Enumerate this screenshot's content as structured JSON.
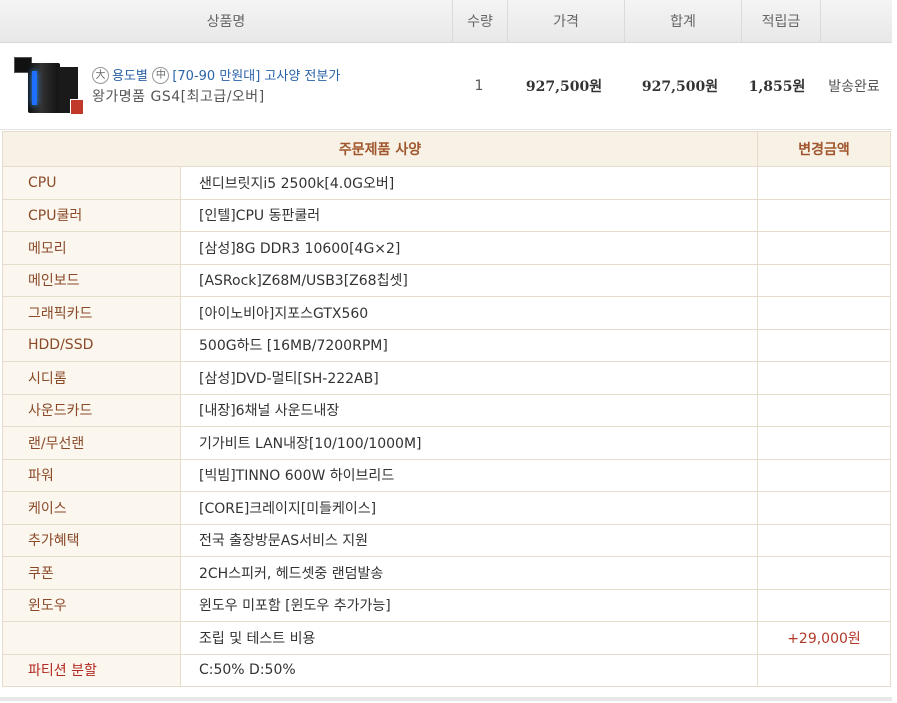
{
  "order_header": {
    "product": "상품명",
    "qty": "수량",
    "price": "가격",
    "total": "합계",
    "points": "적립금",
    "status": ""
  },
  "product": {
    "icon_big": "大",
    "category_a": "용도별",
    "icon_mid": "中",
    "category_b": "[70-90 만원대] 고사양 전분가",
    "name": "왕가명품 GS4[최고급/오버]",
    "qty": "1",
    "price": "927,500원",
    "total": "927,500원",
    "points": "1,855원",
    "status": "발송완료"
  },
  "spec_header": {
    "spec": "주문제품 사양",
    "change": "변경금액"
  },
  "specs": [
    {
      "label": "CPU",
      "value": "샌디브릿지i5 2500k[4.0G오버]",
      "change": ""
    },
    {
      "label": "CPU쿨러",
      "value": "[인텔]CPU 동판쿨러",
      "change": ""
    },
    {
      "label": "메모리",
      "value": "[삼성]8G DDR3 10600[4G×2]",
      "change": ""
    },
    {
      "label": "메인보드",
      "value": "[ASRock]Z68M/USB3[Z68칩셋]",
      "change": ""
    },
    {
      "label": "그래픽카드",
      "value": "[아이노비아]지포스GTX560",
      "change": ""
    },
    {
      "label": "HDD/SSD",
      "value": "500G하드 [16MB/7200RPM]",
      "change": ""
    },
    {
      "label": "시디롬",
      "value": "[삼성]DVD-멀티[SH-222AB]",
      "change": ""
    },
    {
      "label": "사운드카드",
      "value": "[내장]6채널 사운드내장",
      "change": ""
    },
    {
      "label": "랜/무선랜",
      "value": "기가비트 LAN내장[10/100/1000M]",
      "change": ""
    },
    {
      "label": "파워",
      "value": "[빅빔]TINNO 600W 하이브리드",
      "change": ""
    },
    {
      "label": "케이스",
      "value": "[CORE]크레이지[미들케이스]",
      "change": ""
    },
    {
      "label": "추가혜택",
      "value": "전국 출장방문AS서비스 지원",
      "change": ""
    },
    {
      "label": "쿠폰",
      "value": "2CH스피커, 헤드셋중 랜덤발송",
      "change": ""
    },
    {
      "label": "윈도우",
      "value": "윈도우 미포함 [윈도우 추가가능]",
      "change": ""
    },
    {
      "label": "",
      "value": "조립 및 테스트 비용",
      "change": "+29,000원"
    },
    {
      "label": "파티션 분할",
      "value": "C:50% D:50%",
      "change": ""
    }
  ]
}
